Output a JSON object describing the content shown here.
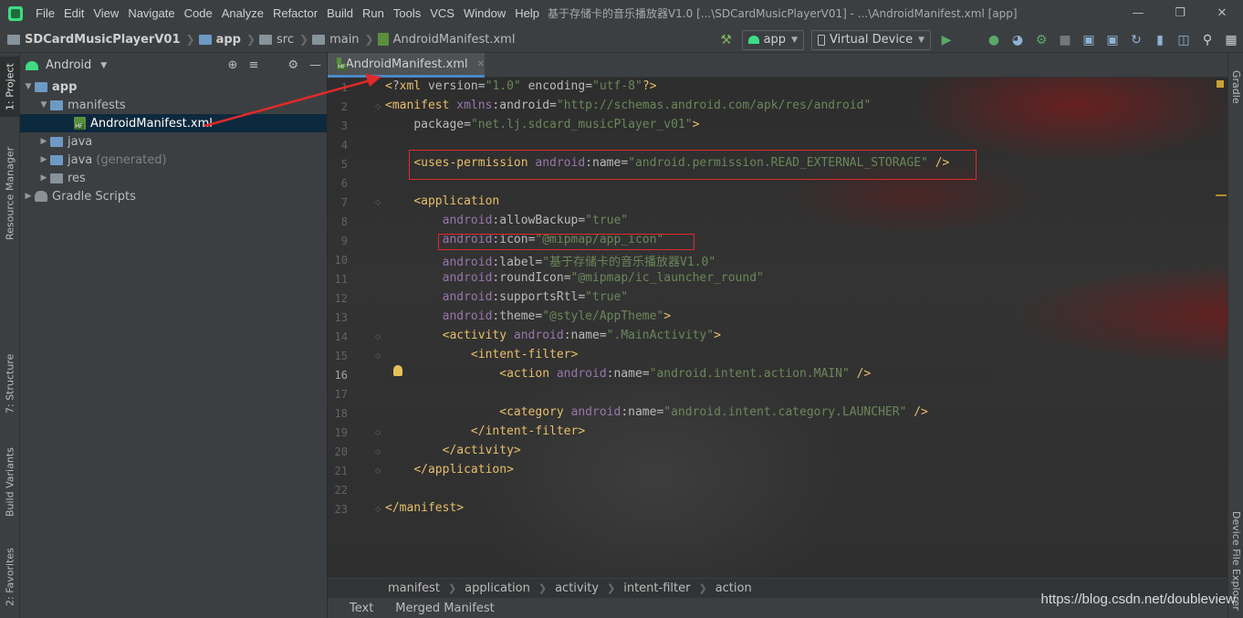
{
  "menubar": {
    "items": [
      "File",
      "Edit",
      "View",
      "Navigate",
      "Code",
      "Analyze",
      "Refactor",
      "Build",
      "Run",
      "Tools",
      "VCS",
      "Window",
      "Help"
    ],
    "window_title": "基于存储卡的音乐播放器V1.0 [...\\SDCardMusicPlayerV01] - ...\\AndroidManifest.xml [app]"
  },
  "navbar": {
    "crumbs": [
      "SDCardMusicPlayerV01",
      "app",
      "src",
      "main",
      "AndroidManifest.xml"
    ],
    "run_config": "app",
    "device": "Virtual Device"
  },
  "leftstrip": {
    "tabs": [
      "1: Project",
      "Resource Manager",
      "7: Structure",
      "Build Variants",
      "2: Favorites"
    ]
  },
  "project": {
    "view_mode": "Android",
    "tree": [
      {
        "label": "app",
        "level": 0,
        "expanded": true,
        "bold": true
      },
      {
        "label": "manifests",
        "level": 1,
        "expanded": true
      },
      {
        "label": "AndroidManifest.xml",
        "level": 2,
        "selected": true
      },
      {
        "label": "java",
        "level": 1,
        "expanded": false
      },
      {
        "label": "java",
        "suffix": "(generated)",
        "level": 1,
        "expanded": false
      },
      {
        "label": "res",
        "level": 1,
        "expanded": false
      },
      {
        "label": "Gradle Scripts",
        "level": 0,
        "expanded": false
      }
    ]
  },
  "editor": {
    "tab_label": "AndroidManifest.xml",
    "current_line": 16,
    "lines": [
      "<?xml version=\"1.0\" encoding=\"utf-8\"?>",
      "<manifest xmlns:android=\"http://schemas.android.com/apk/res/android\"",
      "    package=\"net.lj.sdcard_musicPlayer_v01\">",
      "",
      "    <uses-permission android:name=\"android.permission.READ_EXTERNAL_STORAGE\" />",
      "",
      "    <application",
      "        android:allowBackup=\"true\"",
      "        android:icon=\"@mipmap/app_icon\"",
      "        android:label=\"基于存储卡的音乐播放器V1.0\"",
      "        android:roundIcon=\"@mipmap/ic_launcher_round\"",
      "        android:supportsRtl=\"true\"",
      "        android:theme=\"@style/AppTheme\">",
      "        <activity android:name=\".MainActivity\">",
      "            <intent-filter>",
      "                <action android:name=\"android.intent.action.MAIN\" />",
      "",
      "                <category android:name=\"android.intent.category.LAUNCHER\" />",
      "            </intent-filter>",
      "        </activity>",
      "    </application>",
      "",
      "</manifest>"
    ]
  },
  "rightstrip": {
    "tabs": [
      "Gradle",
      "Device File Explorer"
    ]
  },
  "editor_breadcrumbs": [
    "manifest",
    "application",
    "activity",
    "intent-filter",
    "action"
  ],
  "bottom_tabs": [
    "Text",
    "Merged Manifest"
  ],
  "watermark": "https://blog.csdn.net/doubleview",
  "colors": {
    "tag": "#e8bf6a",
    "namespace": "#9876aa",
    "value": "#6a8759",
    "annotation_red": "#e02a2a",
    "selection": "#0d293e",
    "tab_underline": "#4a88c7"
  }
}
